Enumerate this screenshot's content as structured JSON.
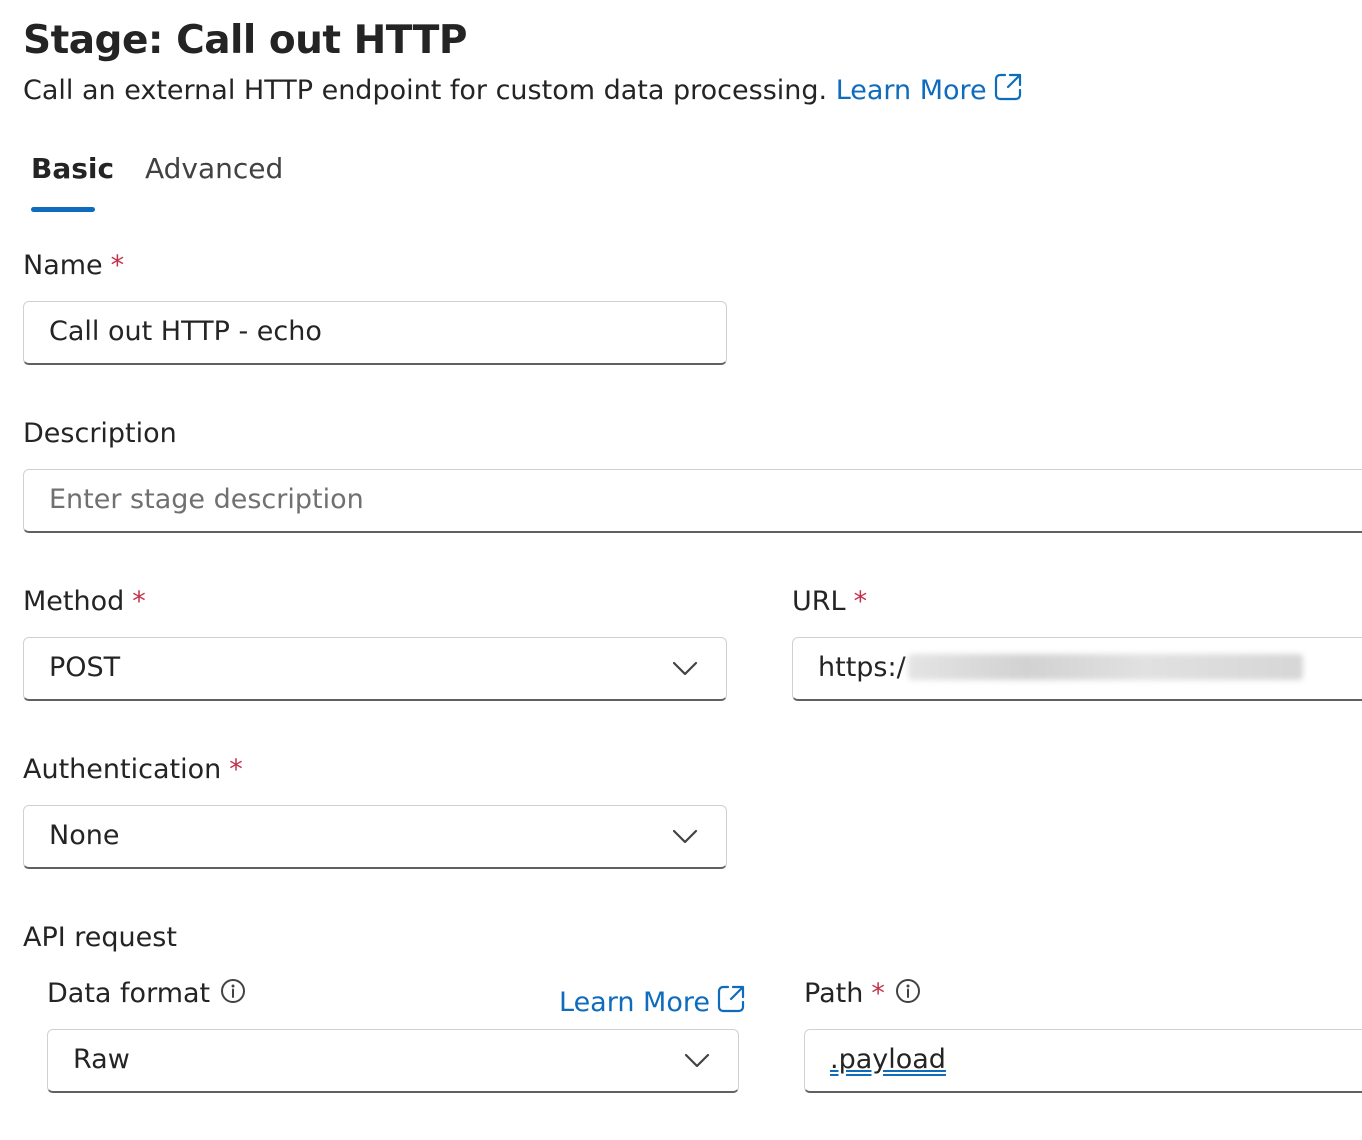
{
  "header": {
    "title": "Stage: Call out HTTP",
    "description": "Call an external HTTP endpoint for custom data processing.",
    "learn_more": "Learn More"
  },
  "tabs": [
    {
      "label": "Basic",
      "selected": true
    },
    {
      "label": "Advanced",
      "selected": false
    }
  ],
  "form": {
    "required_marker": "*",
    "name": {
      "label": "Name",
      "value": "Call out HTTP - echo"
    },
    "description": {
      "label": "Description",
      "placeholder": "Enter stage description"
    },
    "method": {
      "label": "Method",
      "value": "POST"
    },
    "url": {
      "label": "URL",
      "value_visible": "https:/"
    },
    "authentication": {
      "label": "Authentication",
      "value": "None"
    },
    "api_request": {
      "label": "API request",
      "data_format": {
        "label": "Data format",
        "value": "Raw",
        "learn_more": "Learn More"
      },
      "path": {
        "label": "Path",
        "value": ".payload"
      }
    }
  },
  "colors": {
    "accent": "#0f6cbd",
    "required": "#c4314b",
    "text": "#242424"
  }
}
